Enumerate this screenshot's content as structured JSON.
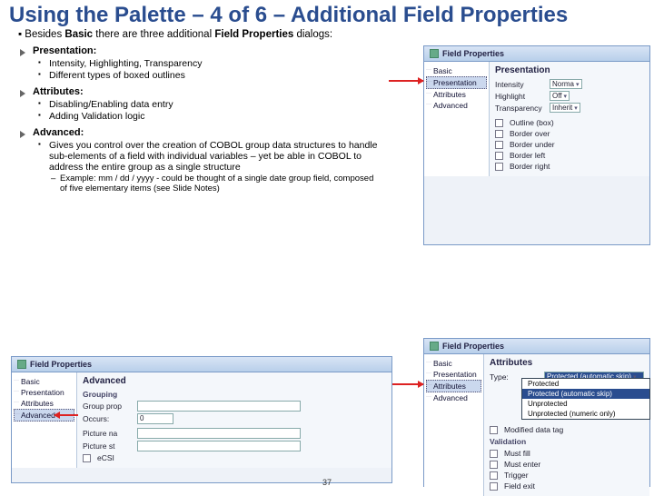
{
  "title": "Using the Palette – 4 of 6 – Additional Field Properties",
  "bullets": {
    "intro_pre": "Besides ",
    "intro_bold1": "Basic",
    "intro_mid": " there are three additional ",
    "intro_bold2": "Field Properties",
    "intro_post": " dialogs:",
    "presentation": "Presentation:",
    "p1": "Intensity, Highlighting, Transparency",
    "p2": "Different types of boxed outlines",
    "attributes": "Attributes:",
    "a1": "Disabling/Enabling data entry",
    "a2": "Adding Validation logic",
    "advanced": "Advanced:",
    "adv1": "Gives you control over the creation of COBOL group data structures to handle sub-elements of a field with individual variables – yet be able in COBOL to address the entire group as a single structure",
    "adv_ex": "Example:  mm  /  dd  /  yyyy   - could be thought of a single date group field, composed of five elementary items (see Slide Notes)"
  },
  "panels": {
    "field_props": "Field Properties",
    "tree": {
      "basic": "Basic",
      "presentation": "Presentation",
      "attributes": "Attributes",
      "advanced": "Advanced"
    },
    "presentation": {
      "heading": "Presentation",
      "intensity": "Intensity",
      "intensity_v": "Norma",
      "highlight": "Highlight",
      "highlight_v": "Off",
      "transparency": "Transparency",
      "transparency_v": "Inherit",
      "outline": "Outline (box)",
      "bover": "Border over",
      "bunder": "Border under",
      "bleft": "Border left",
      "bright": "Border right"
    },
    "advanced": {
      "heading": "Advanced",
      "grouping": "Grouping",
      "group_prop": "Group prop",
      "occurs": "Occurs:",
      "occurs_v": "0",
      "picture_na": "Picture na",
      "picture_st": "Picture st",
      "ecsi": "eCSI"
    },
    "attributes": {
      "heading": "Attributes",
      "type": "Type:",
      "dd": {
        "o1": "Protected",
        "o2": "Protected (automatic skip)",
        "o3": "Unprotected",
        "o4": "Unprotected (numeric only)"
      },
      "type_v": "Protected (automatic skip)",
      "modified": "Modified data tag",
      "validation": "Validation",
      "mustfill": "Must fill",
      "mustenter": "Must enter",
      "trigger": "Trigger",
      "fieldexit": "Field exit"
    }
  },
  "page": "37"
}
